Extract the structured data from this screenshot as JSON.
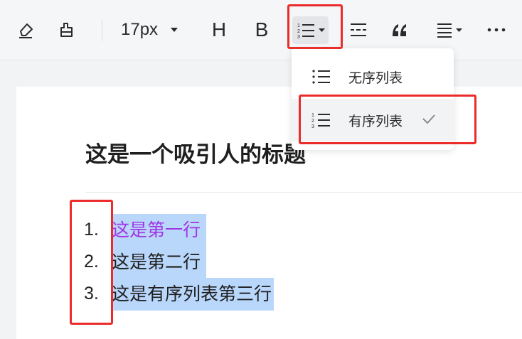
{
  "toolbar": {
    "font_size": "17px",
    "heading_label": "H",
    "bold_label": "B",
    "icons": [
      "eraser-icon",
      "format-painter-icon",
      "chevron-down-icon",
      "ordered-list-icon",
      "divider-icon",
      "quote-icon",
      "align-icon",
      "more-icon"
    ]
  },
  "dropdown": {
    "items": [
      {
        "label": "无序列表",
        "icon": "unordered-list-icon",
        "selected": false
      },
      {
        "label": "有序列表",
        "icon": "ordered-list-icon",
        "selected": true
      }
    ]
  },
  "document": {
    "title": "这是一个吸引人的标题",
    "list": [
      {
        "number": "1.",
        "text": "这是第一行",
        "color": "#a035e6"
      },
      {
        "number": "2.",
        "text": "这是第二行",
        "color": "#1f1f1f"
      },
      {
        "number": "3.",
        "text": "这是有序列表第三行",
        "color": "#1f1f1f"
      }
    ]
  },
  "colors": {
    "highlight_box": "#ec2b2b",
    "selection": "#b9d6fb",
    "first_line_text": "#a035e6"
  }
}
